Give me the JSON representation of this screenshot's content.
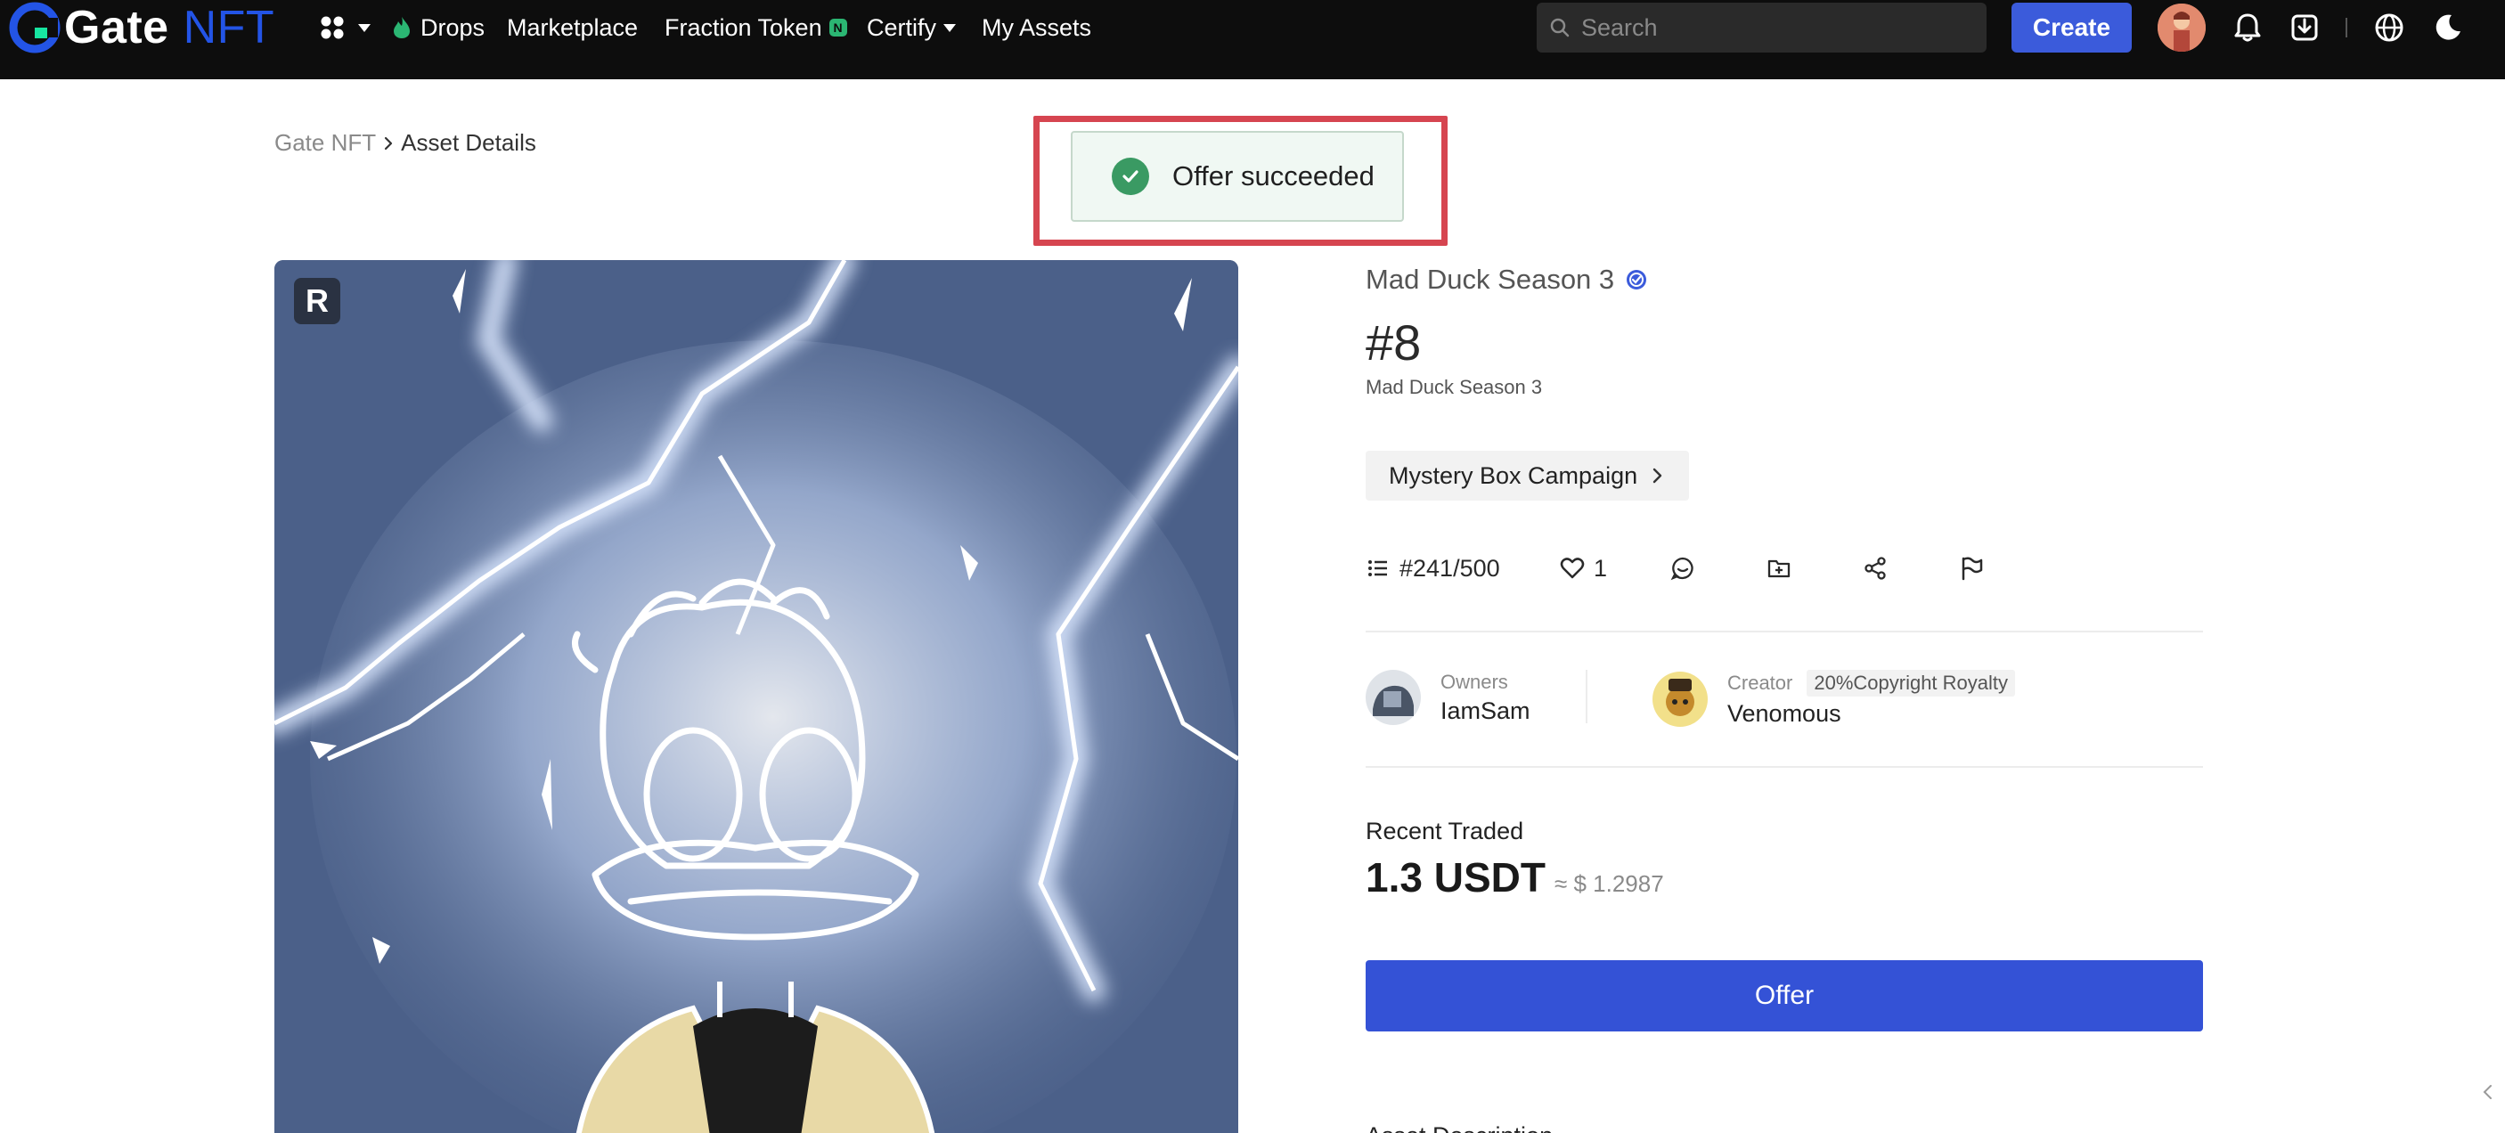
{
  "header": {
    "logo_text_1": "Gate",
    "logo_text_2": "NFT",
    "nav": {
      "drops": "Drops",
      "marketplace": "Marketplace",
      "fraction_token": "Fraction Token",
      "fraction_badge": "N",
      "certify": "Certify",
      "my_assets": "My Assets"
    },
    "search_placeholder": "Search",
    "create_label": "Create",
    "brand_color": "#3b5bdb"
  },
  "breadcrumb": {
    "root": "Gate NFT",
    "current": "Asset Details"
  },
  "toast": {
    "message": "Offer succeeded",
    "status": "success"
  },
  "asset": {
    "rarity": "R",
    "collection": "Mad Duck Season 3",
    "token_id": "#8",
    "subname": "Mad Duck Season 3",
    "campaign_label": "Mystery Box Campaign",
    "edition": "#241/500",
    "likes": "1",
    "owners_label": "Owners",
    "owner_name": "IamSam",
    "creator_label": "Creator",
    "royalty": "20%Copyright Royalty",
    "creator_name": "Venomous",
    "recent_traded_label": "Recent Traded",
    "price": "1.3 USDT",
    "price_usd": "≈ $ 1.2987",
    "offer_label": "Offer",
    "next_section": "Asset Description"
  }
}
